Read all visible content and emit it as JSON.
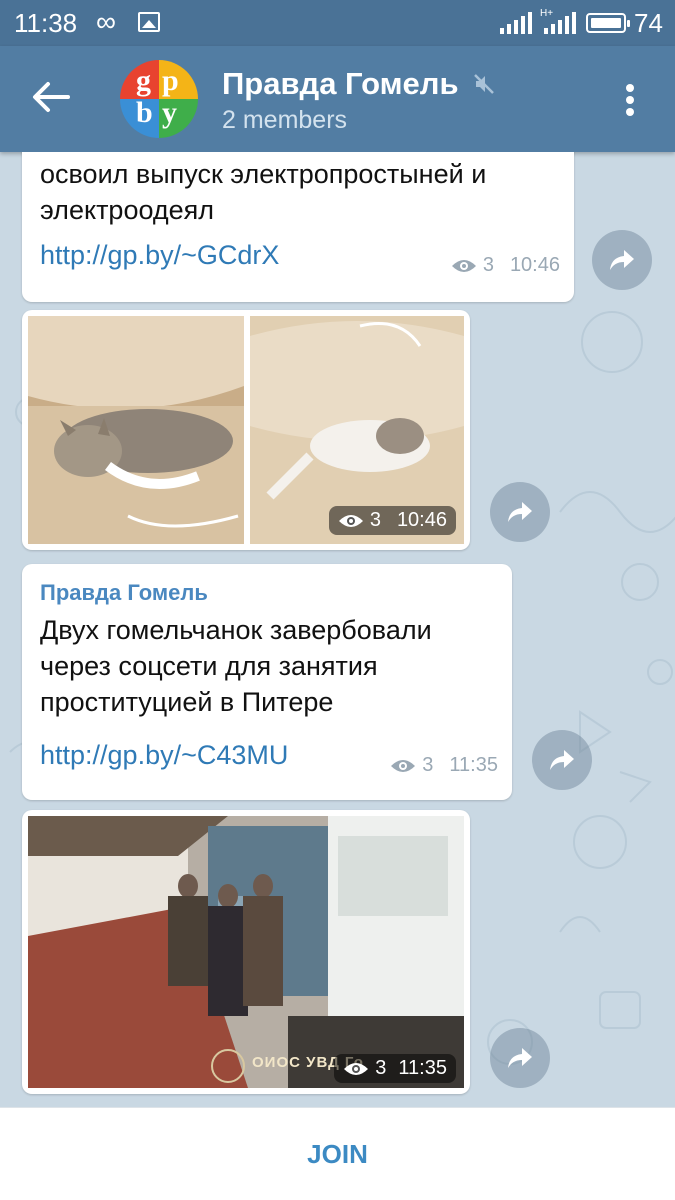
{
  "status_bar": {
    "time": "11:38",
    "infinity_icon": "∞",
    "battery_level": "74",
    "network_label": "H+"
  },
  "header": {
    "title": "Правда Гомель",
    "subtitle": "2 members",
    "avatar_letters": [
      "g",
      "p",
      "b",
      "y"
    ]
  },
  "messages": [
    {
      "type": "text",
      "text_lines": [
        "освоил выпуск электропростыней и",
        "электроодеял"
      ],
      "link": "http://gp.by/~GCdrX",
      "views": "3",
      "time": "10:46"
    },
    {
      "type": "photos",
      "description_icons": [
        "cat-photo",
        "cat-photo"
      ],
      "views": "3",
      "time": "10:46"
    },
    {
      "type": "text",
      "author": "Правда Гомель",
      "text_lines": [
        "Двух гомельчанок завербовали",
        "через соцсети для занятия",
        "проституцией в Питере"
      ],
      "link": "http://gp.by/~C43MU",
      "views": "3",
      "time": "11:35"
    },
    {
      "type": "photo",
      "watermark": "ОИОС УВД Го",
      "views": "3",
      "time": "11:35"
    }
  ],
  "bottom_bar": {
    "join_label": "JOIN"
  },
  "colors": {
    "header": "#527da3",
    "statusbar": "#4a7296",
    "link": "#2f7ab6",
    "author": "#4a88c0",
    "chat_bg": "#c9d8e3"
  },
  "icons": [
    "back-arrow-icon",
    "mute-icon",
    "menu-dots-icon",
    "eye-icon",
    "share-icon",
    "signal-icon",
    "battery-icon",
    "image-icon"
  ]
}
